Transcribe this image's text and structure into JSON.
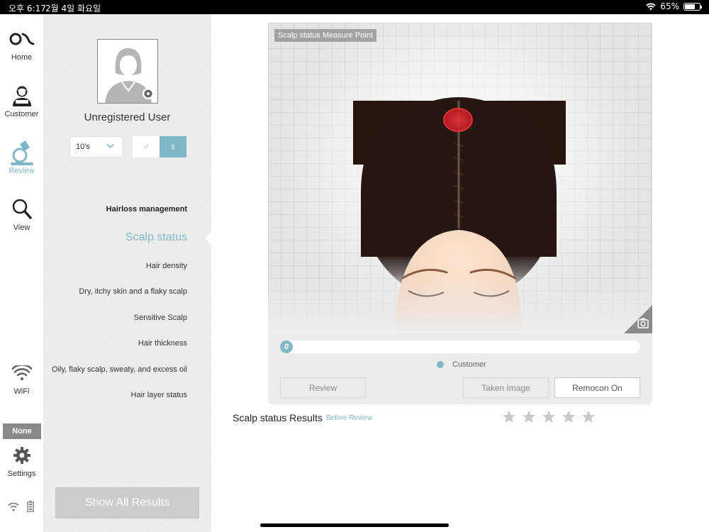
{
  "status_bar": {
    "time": "오후 6:17",
    "date": "2월 4일 화요일",
    "battery": "65%"
  },
  "nav": {
    "home": "Home",
    "customer": "Customer",
    "review": "Review",
    "view": "View",
    "wifi": "WiFi",
    "none_badge": "None",
    "settings": "Settings",
    "accent_color": "#7fb8c8"
  },
  "profile": {
    "username": "Unregistered User",
    "age_group": "10's",
    "gender_male": "♂",
    "gender_female": "♀",
    "selected_gender": "female"
  },
  "menu": {
    "heading": "Hairloss management",
    "active": "Scalp status",
    "items": [
      "Hair density",
      "Dry, itchy skin and a flaky scalp",
      "Sensitive Scalp",
      "Hair thickness",
      "Oily, flaky scalp, sweaty, and excess oil",
      "Hair layer status"
    ],
    "show_all": "Show All Results"
  },
  "viewer": {
    "label": "Scalp status Measure Point",
    "progress_value": "0",
    "legend": "Customer",
    "buttons": {
      "review": "Review",
      "taken": "Taken Image",
      "remocon": "Remocon On"
    }
  },
  "results": {
    "title": "Scalp status Results",
    "subtitle": "Before Review",
    "stars_filled": 0,
    "stars_total": 5
  }
}
